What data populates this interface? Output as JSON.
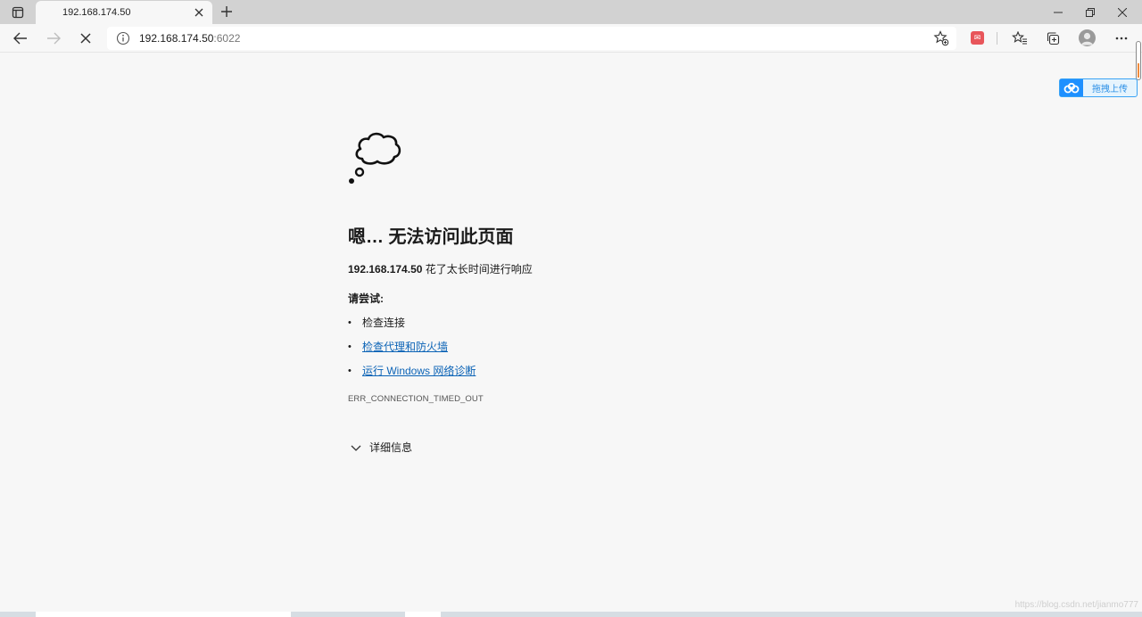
{
  "tab": {
    "title": "192.168.174.50"
  },
  "address_bar": {
    "host": "192.168.174.50",
    "port": ":6022"
  },
  "upload_widget": {
    "label": "拖拽上传"
  },
  "error_page": {
    "title": "嗯… 无法访问此页面",
    "host": "192.168.174.50",
    "description": " 花了太长时间进行响应",
    "try_label": "请尝试:",
    "suggestions": [
      "检查连接",
      "检查代理和防火墙",
      "运行 Windows 网络诊断"
    ],
    "error_code": "ERR_CONNECTION_TIMED_OUT",
    "details_label": "详细信息"
  },
  "watermark": "https://blog.csdn.net/jianmo777",
  "colors": {
    "link": "#0b63b6",
    "accent_upload": "#1e90ff",
    "extension_badge": "#e8555a",
    "scroll_marker": "#f08a3c"
  }
}
